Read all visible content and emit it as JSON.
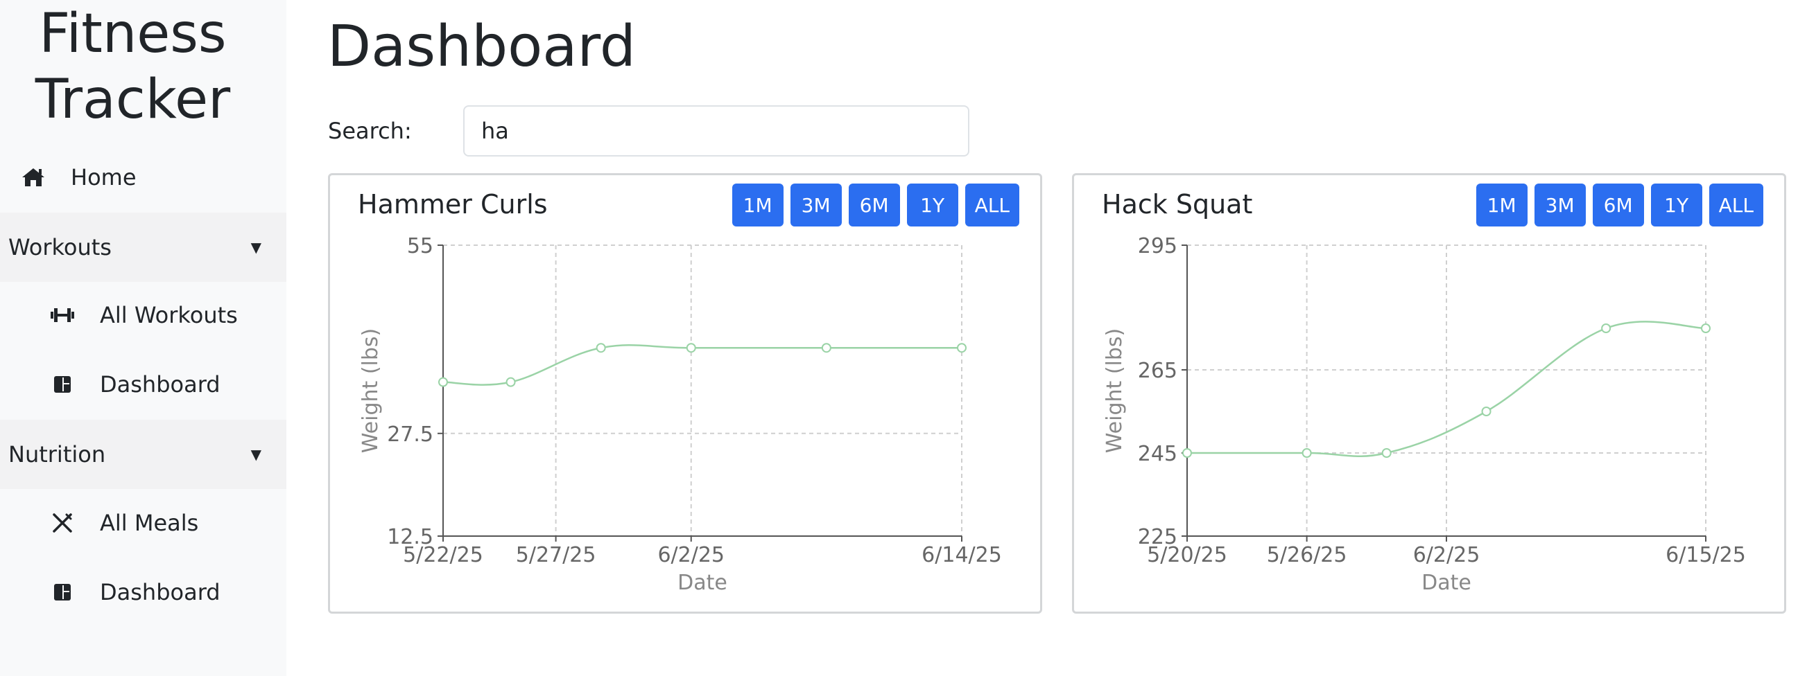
{
  "sidebar": {
    "brand": "Fitness Tracker",
    "home": {
      "label": "Home",
      "icon": "home-icon"
    },
    "sections": [
      {
        "label": "Workouts",
        "items": [
          {
            "label": "All Workouts",
            "icon": "dumbbell-icon"
          },
          {
            "label": "Dashboard",
            "icon": "dashboard-icon"
          }
        ]
      },
      {
        "label": "Nutrition",
        "items": [
          {
            "label": "All Meals",
            "icon": "utensils-icon"
          },
          {
            "label": "Dashboard",
            "icon": "dashboard-icon"
          }
        ]
      }
    ]
  },
  "main": {
    "title": "Dashboard",
    "search": {
      "label": "Search:",
      "value": "ha"
    }
  },
  "range_buttons": [
    "1M",
    "3M",
    "6M",
    "1Y",
    "ALL"
  ],
  "colors": {
    "accent": "#2b6ef0",
    "line": "#9ad3a6"
  },
  "chart_data": [
    {
      "type": "line",
      "title": "Hammer Curls",
      "xlabel": "Date",
      "ylabel": "Weight (lbs)",
      "x_ticks": [
        "5/22/25",
        "5/27/25",
        "6/2/25",
        "6/14/25"
      ],
      "y_ticks": [
        "12.5",
        "27.5",
        "55"
      ],
      "ylim": [
        12.5,
        55
      ],
      "xlim": [
        "5/22/25",
        "6/14/25"
      ],
      "grid": true,
      "points": [
        {
          "x": "5/22/25",
          "y": 35
        },
        {
          "x": "5/25/25",
          "y": 35
        },
        {
          "x": "5/29/25",
          "y": 40
        },
        {
          "x": "6/2/25",
          "y": 40
        },
        {
          "x": "6/8/25",
          "y": 40
        },
        {
          "x": "6/14/25",
          "y": 40
        }
      ]
    },
    {
      "type": "line",
      "title": "Hack Squat",
      "xlabel": "Date",
      "ylabel": "Weight (lbs)",
      "x_ticks": [
        "5/20/25",
        "5/26/25",
        "6/2/25",
        "6/15/25"
      ],
      "y_ticks": [
        "225",
        "245",
        "265",
        "295"
      ],
      "ylim": [
        225,
        295
      ],
      "xlim": [
        "5/20/25",
        "6/15/25"
      ],
      "grid": true,
      "points": [
        {
          "x": "5/20/25",
          "y": 245
        },
        {
          "x": "5/26/25",
          "y": 245
        },
        {
          "x": "5/30/25",
          "y": 245
        },
        {
          "x": "6/4/25",
          "y": 255
        },
        {
          "x": "6/10/25",
          "y": 275
        },
        {
          "x": "6/15/25",
          "y": 275
        }
      ]
    }
  ]
}
